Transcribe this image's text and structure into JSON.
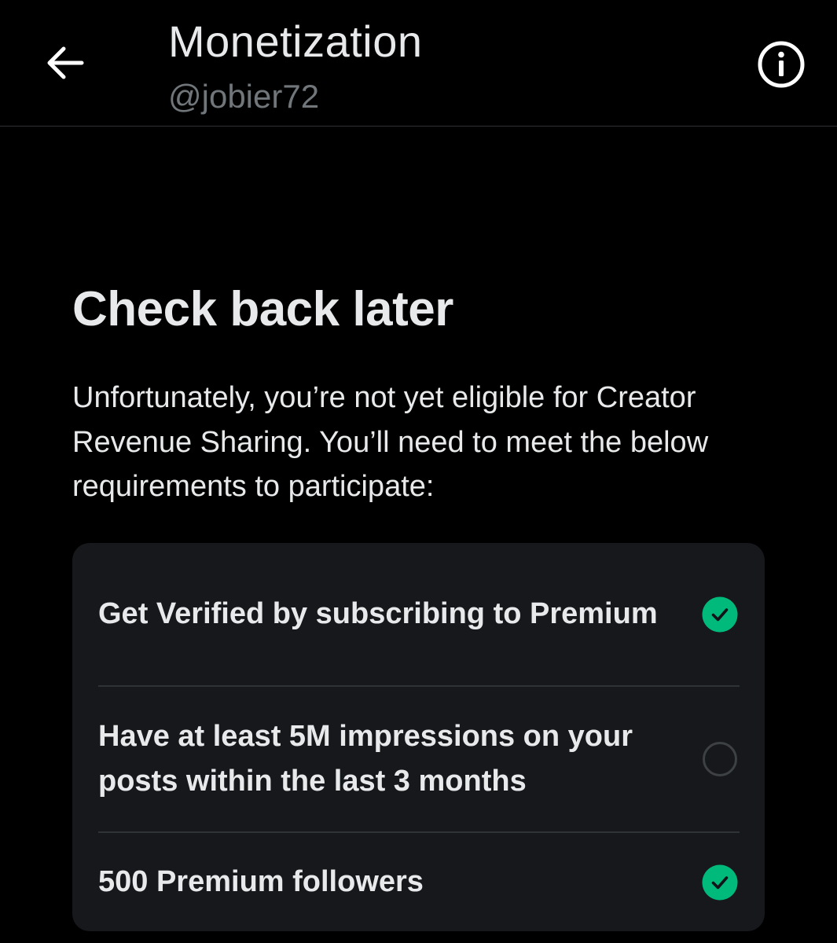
{
  "header": {
    "title": "Monetization",
    "handle": "@jobier72",
    "back_icon": "arrow-left-icon",
    "info_icon": "info-circle-icon"
  },
  "main": {
    "heading": "Check back later",
    "description": "Unfortunately, you’re not yet eligible for Creator Revenue Sharing. You’ll need to meet the below requirements to participate:"
  },
  "requirements": [
    {
      "label": "Get Verified by subscribing to Premium",
      "met": true,
      "status_icon": "check-circle-icon"
    },
    {
      "label": "Have at least 5M impressions on your posts within the last 3 months",
      "met": false,
      "status_icon": "empty-circle-icon"
    },
    {
      "label": "500 Premium followers",
      "met": true,
      "status_icon": "check-circle-icon"
    }
  ],
  "colors": {
    "background": "#000000",
    "card": "#16181c",
    "text_primary": "#e7e9ea",
    "text_secondary": "#71767b",
    "success": "#00ba7c",
    "divider": "#2f3336"
  }
}
